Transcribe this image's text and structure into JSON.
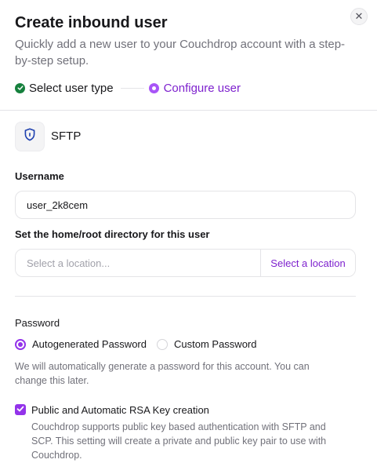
{
  "dialog": {
    "title": "Create inbound user",
    "subtitle": "Quickly add a new user to your Couchdrop account with a step-by-step setup.",
    "close_icon": "close-icon"
  },
  "stepper": {
    "steps": [
      {
        "label": "Select user type",
        "state": "complete",
        "icon": "check-circle-icon"
      },
      {
        "label": "Configure user",
        "state": "active",
        "icon": "radio-dot-icon"
      }
    ]
  },
  "protocol": {
    "label": "SFTP",
    "icon": "shield-lock-icon"
  },
  "username": {
    "label": "Username",
    "value": "user_2k8cem"
  },
  "home_directory": {
    "label": "Set the home/root directory for this user",
    "placeholder": "Select a location...",
    "button_label": "Select a location"
  },
  "password": {
    "label": "Password",
    "options": [
      {
        "label": "Autogenerated Password",
        "selected": true
      },
      {
        "label": "Custom Password",
        "selected": false
      }
    ],
    "helper": "We will automatically generate a password for this account. You can change this later."
  },
  "rsa_key": {
    "label": "Public and Automatic RSA Key creation",
    "checked": true,
    "description": "Couchdrop supports public key based authentication with SFTP and SCP. This setting will create a private and public key pair to use with Couchdrop."
  },
  "colors": {
    "accent": "#9333ea",
    "accent_text": "#7e22ce",
    "success": "#15803d",
    "muted_text": "#71717a",
    "border": "#e4e4e7"
  }
}
